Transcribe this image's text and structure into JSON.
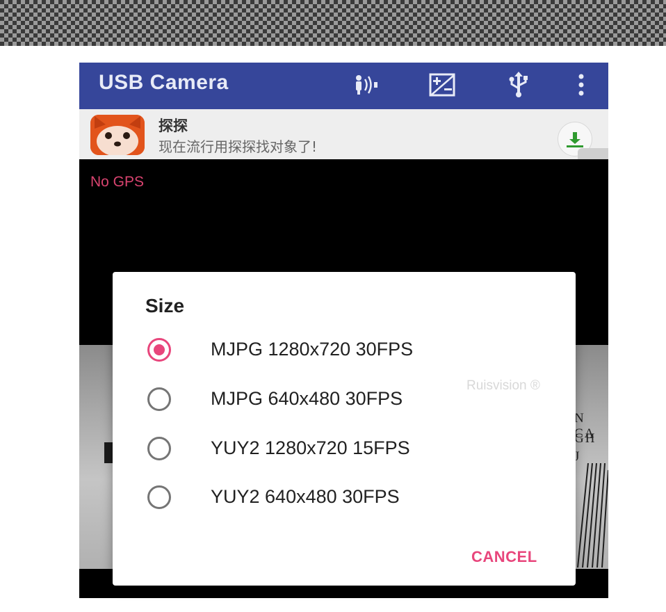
{
  "app_bar": {
    "title": "USB Camera",
    "icons": [
      "voice-wave-icon",
      "exposure-icon",
      "usb-icon",
      "overflow-menu-icon"
    ],
    "color": "#36469a"
  },
  "ad_banner": {
    "app_name": "探探",
    "tagline": "现在流行用探探找对象了!"
  },
  "status": {
    "gps": "No GPS"
  },
  "dialog": {
    "title": "Size",
    "options": [
      {
        "label": "MJPG 1280x720 30FPS",
        "selected": true
      },
      {
        "label": "MJPG 640x480 30FPS",
        "selected": false
      },
      {
        "label": "YUY2 1280x720 15FPS",
        "selected": false
      },
      {
        "label": "YUY2 640x480 30FPS",
        "selected": false
      }
    ],
    "watermark": "Ruisvision ®",
    "cancel_label": "CANCEL",
    "accent": "#e8467c"
  },
  "preview": {
    "text_line_1": "N CA",
    "text_line_2": "GH",
    "text_line_3": "J"
  }
}
